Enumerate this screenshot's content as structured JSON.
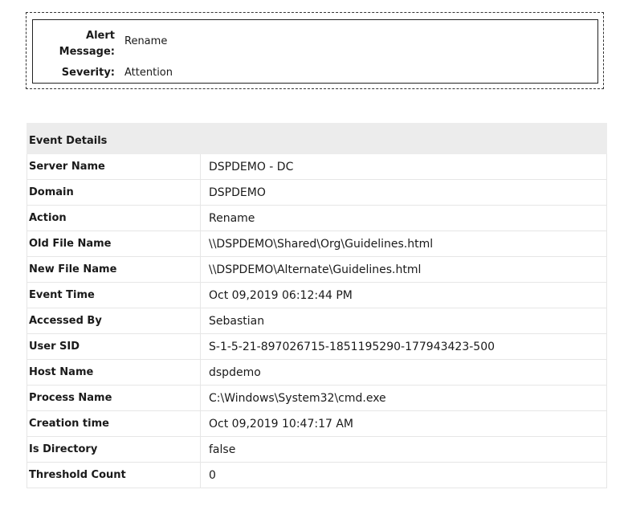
{
  "alert": {
    "message_label": "Alert Message:",
    "message_value": "Rename",
    "severity_label": "Severity:",
    "severity_value": "Attention"
  },
  "event_details": {
    "header": "Event Details",
    "rows": [
      {
        "label": "Server Name",
        "value": "DSPDEMO - DC"
      },
      {
        "label": "Domain",
        "value": "DSPDEMO"
      },
      {
        "label": "Action",
        "value": "Rename"
      },
      {
        "label": "Old File Name",
        "value": "\\\\DSPDEMO\\Shared\\Org\\Guidelines.html"
      },
      {
        "label": "New File Name",
        "value": "\\\\DSPDEMO\\Alternate\\Guidelines.html"
      },
      {
        "label": "Event Time",
        "value": "Oct 09,2019 06:12:44 PM"
      },
      {
        "label": "Accessed By",
        "value": "Sebastian"
      },
      {
        "label": "User SID",
        "value": "S-1-5-21-897026715-1851195290-177943423-500"
      },
      {
        "label": "Host Name",
        "value": "dspdemo"
      },
      {
        "label": "Process Name",
        "value": "C:\\Windows\\System32\\cmd.exe"
      },
      {
        "label": "Creation time",
        "value": "Oct 09,2019 10:47:17 AM"
      },
      {
        "label": "Is Directory",
        "value": "false"
      },
      {
        "label": "Threshold Count",
        "value": "0"
      }
    ]
  }
}
